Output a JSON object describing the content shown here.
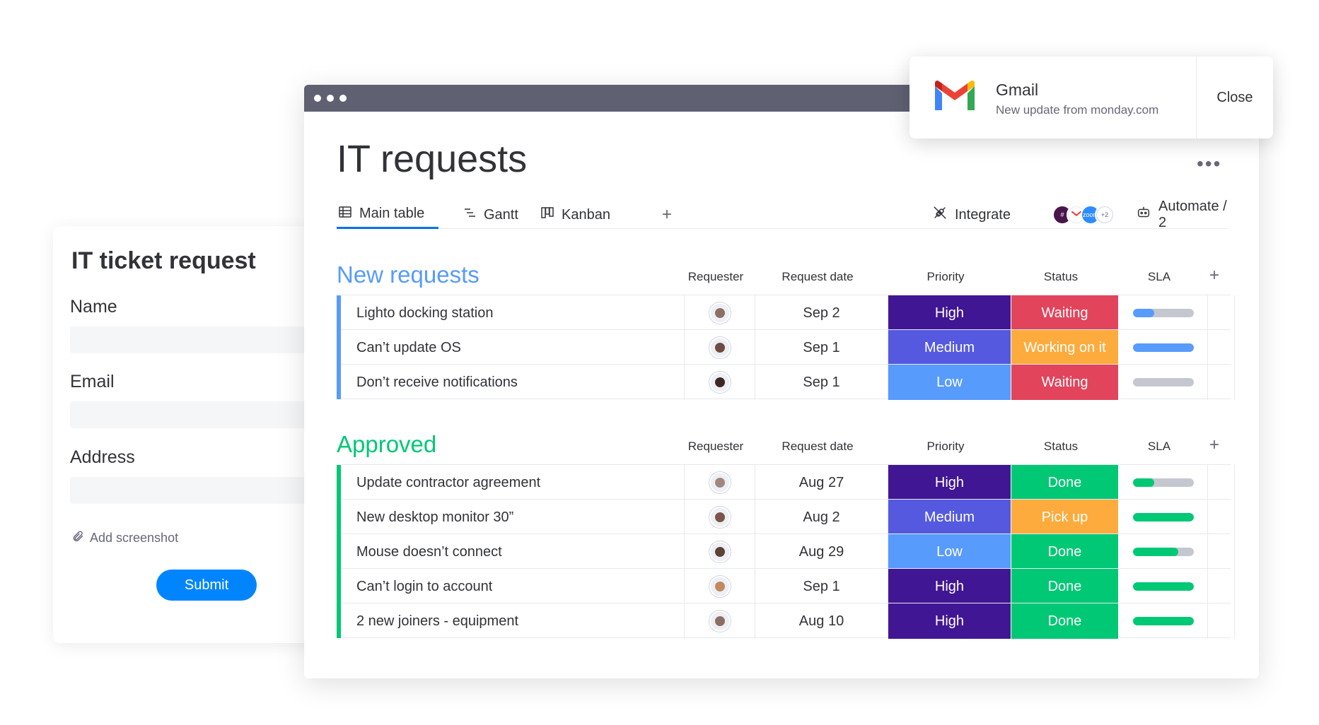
{
  "form": {
    "title": "IT ticket request",
    "fields": [
      {
        "label": "Name",
        "value": ""
      },
      {
        "label": "Email",
        "value": ""
      },
      {
        "label": "Address",
        "value": ""
      }
    ],
    "attach_label": "Add screenshot",
    "submit_label": "Submit"
  },
  "board": {
    "title": "IT requests",
    "tabs": [
      {
        "label": "Main table",
        "icon": "table-icon",
        "active": true
      },
      {
        "label": "Gantt",
        "icon": "gantt-icon",
        "active": false
      },
      {
        "label": "Kanban",
        "icon": "kanban-icon",
        "active": false
      }
    ],
    "integrate_label": "Integrate",
    "integrate_apps_extra": "+2",
    "automate_label": "Automate / 2",
    "columns": [
      "Requester",
      "Request date",
      "Priority",
      "Status",
      "SLA"
    ]
  },
  "colors": {
    "priority": {
      "High": "#401694",
      "Medium": "#5559df",
      "Low": "#579bfc"
    },
    "status": {
      "Waiting": "#e2445c",
      "Working on it": "#fdab3d",
      "Done": "#00c875",
      "Pick up": "#fdab3d"
    },
    "group_new": "#579bfc",
    "group_approved": "#00c875"
  },
  "groups": [
    {
      "title": "New requests",
      "color": "#579bfc",
      "rows": [
        {
          "name": "Lighto docking station",
          "date": "Sep 2",
          "priority": "High",
          "status": "Waiting",
          "sla": 0.35,
          "sla_color": "#579bfc",
          "avatar": "#8d6e63"
        },
        {
          "name": "Can’t update OS",
          "date": "Sep 1",
          "priority": "Medium",
          "status": "Working on it",
          "sla": 1.0,
          "sla_color": "#579bfc",
          "avatar": "#6d4c41"
        },
        {
          "name": "Don’t receive notifications",
          "date": "Sep 1",
          "priority": "Low",
          "status": "Waiting",
          "sla": 0.0,
          "sla_color": "#579bfc",
          "avatar": "#3e2723"
        }
      ]
    },
    {
      "title": "Approved",
      "color": "#00c875",
      "rows": [
        {
          "name": "Update contractor agreement",
          "date": "Aug 27",
          "priority": "High",
          "status": "Done",
          "sla": 0.35,
          "sla_color": "#00c875",
          "avatar": "#a1887f"
        },
        {
          "name": "New desktop monitor 30”",
          "date": "Aug 2",
          "priority": "Medium",
          "status": "Pick up",
          "sla": 1.0,
          "sla_color": "#00c875",
          "avatar": "#795548"
        },
        {
          "name": "Mouse doesn’t connect",
          "date": "Aug 29",
          "priority": "Low",
          "status": "Done",
          "sla": 0.75,
          "sla_color": "#00c875",
          "avatar": "#5d4037"
        },
        {
          "name": "Can’t login to account",
          "date": "Sep 1",
          "priority": "High",
          "status": "Done",
          "sla": 1.0,
          "sla_color": "#00c875",
          "avatar": "#bf8a5e"
        },
        {
          "name": "2 new joiners - equipment",
          "date": "Aug 10",
          "priority": "High",
          "status": "Done",
          "sla": 1.0,
          "sla_color": "#00c875",
          "avatar": "#8d6e63"
        }
      ]
    }
  ],
  "toast": {
    "title": "Gmail",
    "subtitle": "New update from monday.com",
    "close_label": "Close"
  }
}
